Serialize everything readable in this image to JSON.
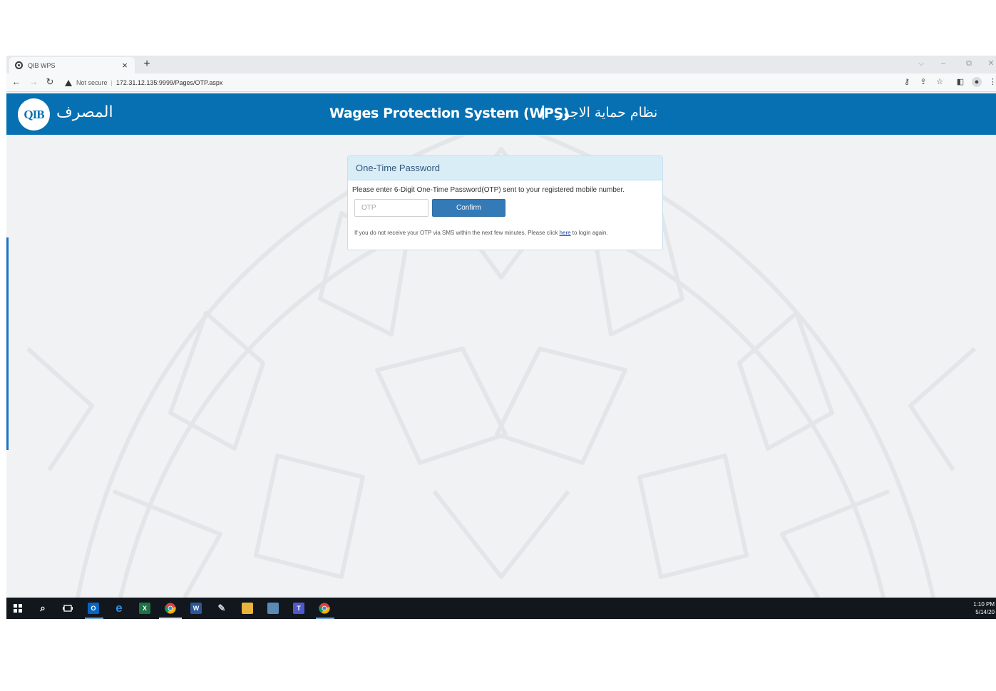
{
  "browser": {
    "tab_title": "QIB WPS",
    "tab_close": "×",
    "new_tab": "+",
    "security_label": "Not secure",
    "separator": "|",
    "url": "172.31.12.135:9999/Pages/OTP.aspx"
  },
  "header": {
    "logo_text": "QIB",
    "bank_name_arabic": "المصرف",
    "system_title": "Wages Protection System (WPS)",
    "divider": "|",
    "system_title_arabic": "نظام حماية الاجور",
    "brand_color": "#0670b2"
  },
  "otp_panel": {
    "heading": "One-Time Password",
    "instructions": "Please enter 6-Digit One-Time Password(OTP) sent to your registered mobile number.",
    "otp_placeholder": "OTP",
    "otp_value": "",
    "confirm_label": "Confirm",
    "note_before": "If you do not receive your OTP via SMS within the next few minutes, Please click ",
    "note_link": "here",
    "note_after": " to login again."
  },
  "taskbar": {
    "time": "1:10 PM",
    "date": "5/14/20",
    "icons": [
      "windows-start-icon",
      "search-icon",
      "task-view-icon",
      "outlook-icon",
      "edge-icon",
      "excel-icon",
      "chrome-icon",
      "word-icon",
      "paint-icon",
      "file-explorer-icon",
      "network-icon",
      "teams-icon",
      "chrome-alt-icon"
    ]
  }
}
